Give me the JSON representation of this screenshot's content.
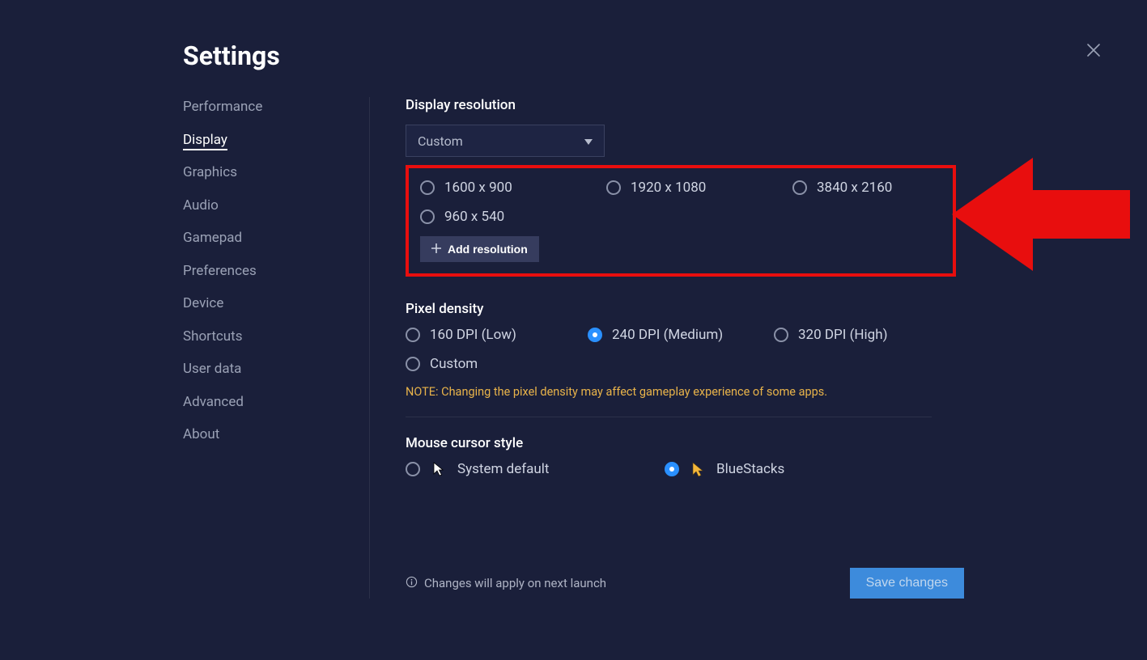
{
  "title": "Settings",
  "nav": [
    "Performance",
    "Display",
    "Graphics",
    "Audio",
    "Gamepad",
    "Preferences",
    "Device",
    "Shortcuts",
    "User data",
    "Advanced",
    "About"
  ],
  "display": {
    "resolution_label": "Display resolution",
    "dropdown_value": "Custom",
    "options": [
      "1600 x 900",
      "1920 x 1080",
      "3840 x 2160",
      "960 x 540"
    ],
    "add_label": "Add resolution"
  },
  "dpi": {
    "label": "Pixel density",
    "options": [
      "160 DPI (Low)",
      "240 DPI (Medium)",
      "320 DPI (High)",
      "Custom"
    ],
    "selected": "240 DPI (Medium)",
    "note": "NOTE: Changing the pixel density may affect gameplay experience of some apps."
  },
  "cursor": {
    "label": "Mouse cursor style",
    "options": [
      "System default",
      "BlueStacks"
    ],
    "selected": "BlueStacks"
  },
  "footer": {
    "info": "Changes will apply on next launch",
    "save": "Save changes"
  }
}
